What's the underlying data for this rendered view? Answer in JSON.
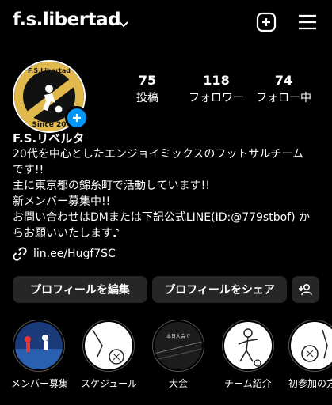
{
  "header": {
    "username": "f.s.libertad"
  },
  "profile": {
    "display_name": "F.S.リベルタ",
    "avatar_text_top": "F.S.Libertad",
    "avatar_text_bottom": "Since 20",
    "stats": [
      {
        "value": "75",
        "label": "投稿"
      },
      {
        "value": "118",
        "label": "フォロワー"
      },
      {
        "value": "74",
        "label": "フォロー中"
      }
    ],
    "bio_lines": [
      "20代を中心としたエンジョイミックスのフットサルチーム",
      "です!!",
      "主に東京都の錦糸町で活動しています!!",
      "新メンバー募集中!!",
      "お問い合わせはDMまたは下記公式LINE(ID:@779stbof) か",
      "らお願いいたします♪"
    ],
    "link": "lin.ee/Hugf7SC"
  },
  "actions": {
    "edit_label": "プロフィールを編集",
    "share_label": "プロフィールをシェア"
  },
  "highlights": [
    {
      "label": "メンバー募集",
      "thumb_text": ""
    },
    {
      "label": "スケジュール",
      "thumb_text": ""
    },
    {
      "label": "大会",
      "thumb_text": "本日大会で"
    },
    {
      "label": "チーム紹介",
      "thumb_text": ""
    },
    {
      "label": "初参加の方",
      "thumb_text": ""
    }
  ],
  "colors": {
    "accent": "#0095f6",
    "button_bg": "#262626",
    "badge_gold": "#e0b84c"
  }
}
